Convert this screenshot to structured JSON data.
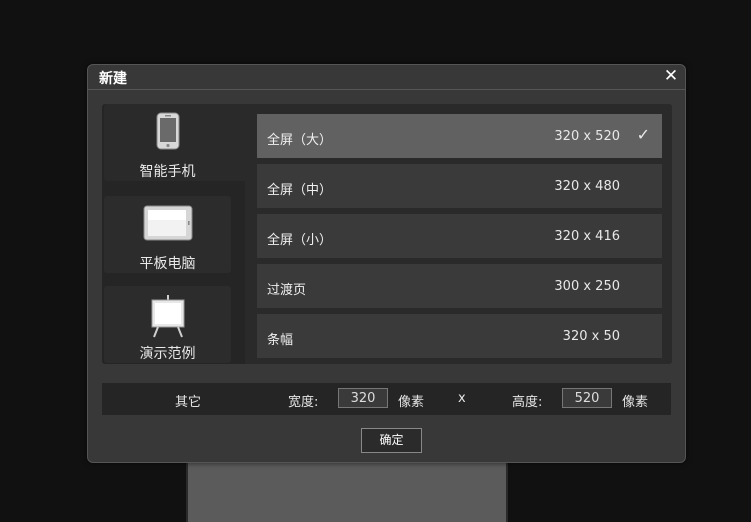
{
  "dialog": {
    "title": "新建",
    "close_glyph": "✕"
  },
  "devices": [
    {
      "label": "智能手机",
      "icon": "smartphone-icon",
      "active": true
    },
    {
      "label": "平板电脑",
      "icon": "tablet-icon",
      "active": false
    },
    {
      "label": "演示范例",
      "icon": "presentation-easel-icon",
      "active": false
    }
  ],
  "presets": [
    {
      "name": "全屏（大）",
      "size": "320 x 520",
      "selected": true
    },
    {
      "name": "全屏（中）",
      "size": "320 x 480",
      "selected": false
    },
    {
      "name": "全屏（小）",
      "size": "320 x 416",
      "selected": false
    },
    {
      "name": "过渡页",
      "size": "300 x 250",
      "selected": false
    },
    {
      "name": "条幅",
      "size": "320 x 50",
      "selected": false
    }
  ],
  "check_glyph": "✓",
  "other": {
    "label": "其它",
    "width_label": "宽度:",
    "width_value": "320",
    "width_unit": "像素",
    "separator": "x",
    "height_label": "高度:",
    "height_value": "520",
    "height_unit": "像素"
  },
  "ok_label": "确定",
  "colors": {
    "selected_row": "#616161",
    "row": "#3a3a3a",
    "dialog_bg": "#383838",
    "page_bg": "#111111"
  }
}
